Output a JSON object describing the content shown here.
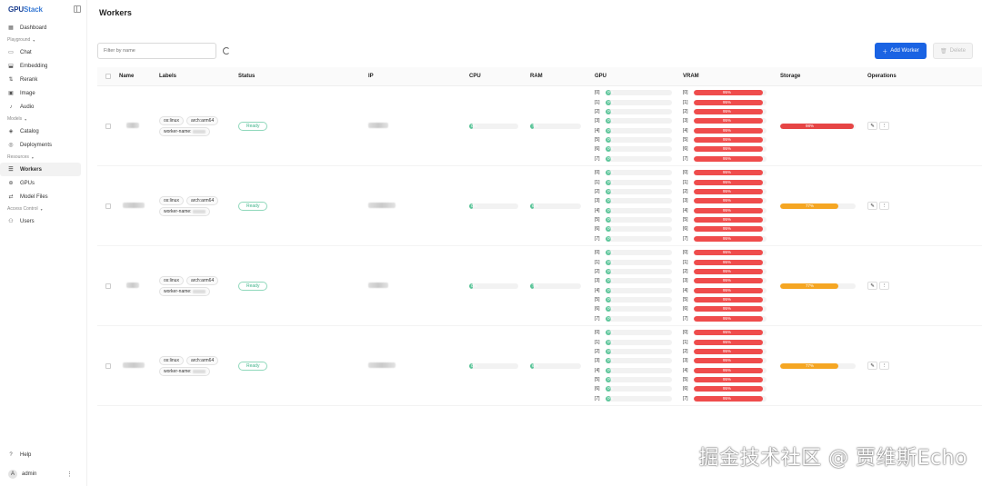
{
  "brand": {
    "logo_a": "GPU",
    "logo_b": "Stack"
  },
  "sidebar": {
    "top": [
      {
        "label": "Dashboard",
        "icon": "dashboard-icon"
      }
    ],
    "sections": [
      {
        "title": "Playground",
        "items": [
          {
            "label": "Chat",
            "icon": "chat-icon"
          },
          {
            "label": "Embedding",
            "icon": "embedding-icon"
          },
          {
            "label": "Rerank",
            "icon": "rerank-icon"
          },
          {
            "label": "Image",
            "icon": "image-icon"
          },
          {
            "label": "Audio",
            "icon": "audio-icon"
          }
        ]
      },
      {
        "title": "Models",
        "items": [
          {
            "label": "Catalog",
            "icon": "catalog-icon"
          },
          {
            "label": "Deployments",
            "icon": "deployments-icon"
          }
        ]
      },
      {
        "title": "Resources",
        "items": [
          {
            "label": "Workers",
            "icon": "workers-icon",
            "active": true
          },
          {
            "label": "GPUs",
            "icon": "gpu-icon"
          },
          {
            "label": "Model Files",
            "icon": "model-files-icon"
          }
        ]
      },
      {
        "title": "Access Control",
        "items": [
          {
            "label": "Users",
            "icon": "users-icon"
          }
        ]
      }
    ],
    "help": "Help",
    "user": {
      "initial": "A",
      "name": "admin"
    }
  },
  "page": {
    "title": "Workers"
  },
  "toolbar": {
    "search_placeholder": "Filter by name",
    "add_label": "Add Worker",
    "delete_label": "Delete"
  },
  "table": {
    "headers": {
      "name": "Name",
      "labels": "Labels",
      "status": "Status",
      "ip": "IP",
      "cpu": "CPU",
      "ram": "RAM",
      "gpu": "GPU",
      "vram": "VRAM",
      "storage": "Storage",
      "ops": "Operations"
    },
    "rows": [
      {
        "labels": [
          "os:linux",
          "arch:arm64",
          "worker-name:"
        ],
        "status": "Ready",
        "cpu": 0,
        "cpu_text": "0%",
        "ram": 7,
        "ram_text": "7%",
        "gpu": [
          0,
          0,
          0,
          0,
          0,
          0,
          0,
          0
        ],
        "gpu_text": "0%",
        "vram": [
          95,
          95,
          95,
          95,
          95,
          95,
          95,
          95
        ],
        "vram_text": "95%",
        "storage": 98,
        "storage_text": "98%",
        "storage_color": "crimson"
      },
      {
        "labels": [
          "os:linux",
          "arch:arm64",
          "worker-name:"
        ],
        "status": "Ready",
        "cpu": 0,
        "cpu_text": "0%",
        "ram": 6,
        "ram_text": "6%",
        "gpu": [
          0,
          0,
          0,
          0,
          0,
          0,
          0,
          0
        ],
        "gpu_text": "0%",
        "vram": [
          95,
          95,
          95,
          95,
          95,
          95,
          95,
          95
        ],
        "vram_text": "95%",
        "storage": 77,
        "storage_text": "77%",
        "storage_color": "orange"
      },
      {
        "labels": [
          "os:linux",
          "arch:arm64",
          "worker-name:"
        ],
        "status": "Ready",
        "cpu": 0,
        "cpu_text": "0%",
        "ram": 7,
        "ram_text": "7%",
        "gpu": [
          0,
          0,
          0,
          0,
          0,
          0,
          0,
          0
        ],
        "gpu_text": "0%",
        "vram": [
          95,
          95,
          95,
          95,
          95,
          95,
          95,
          95
        ],
        "vram_text": "95%",
        "storage": 77,
        "storage_text": "77%",
        "storage_color": "orange"
      },
      {
        "labels": [
          "os:linux",
          "arch:arm64",
          "worker-name:"
        ],
        "status": "Ready",
        "cpu": 0,
        "cpu_text": "0%",
        "ram": 6,
        "ram_text": "6%",
        "gpu": [
          0,
          0,
          0,
          0,
          0,
          0,
          0,
          0
        ],
        "gpu_text": "0%",
        "vram": [
          95,
          95,
          95,
          95,
          95,
          95,
          95,
          95
        ],
        "vram_text": "95%",
        "storage": 77,
        "storage_text": "77%",
        "storage_color": "orange"
      }
    ]
  },
  "watermark": "掘金技术社区 @ 贾维斯Echo"
}
